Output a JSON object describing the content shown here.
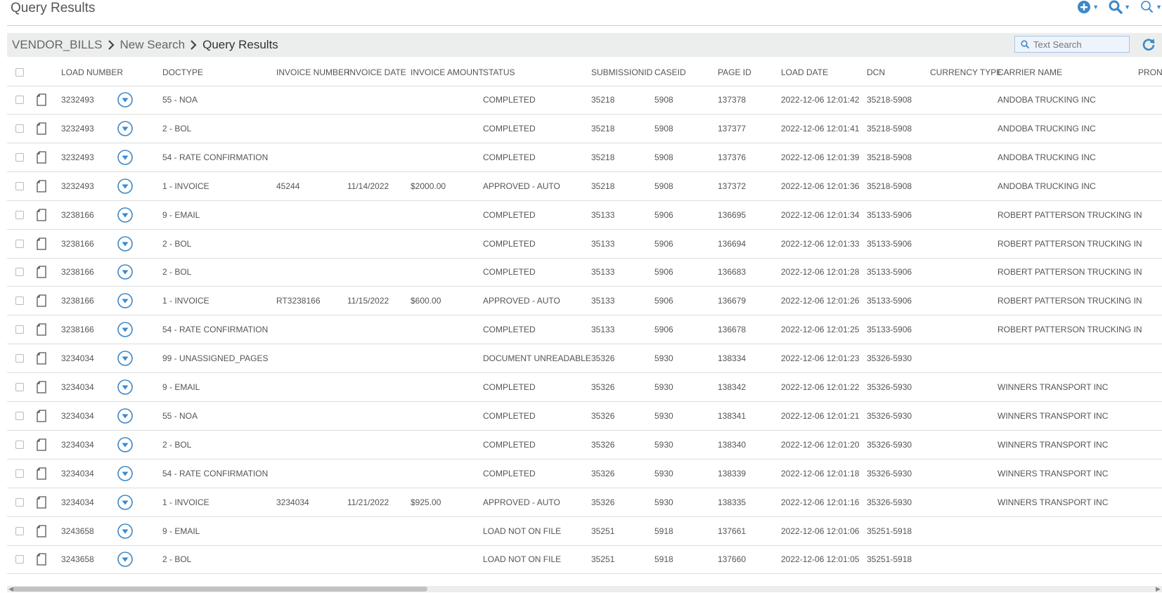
{
  "page": {
    "title": "Query Results"
  },
  "breadcrumb": [
    "VENDOR_BILLS",
    "New Search",
    "Query Results"
  ],
  "search": {
    "placeholder": "Text Search"
  },
  "colors": {
    "accent": "#3d88c8",
    "bar": "#eceded"
  },
  "icons": [
    "plus-circle-icon",
    "search-icon",
    "advanced-search-icon",
    "refresh-icon",
    "gear-icon",
    "document-icon",
    "expand-down-icon"
  ],
  "table": {
    "columns": [
      "LOAD NUMBER",
      "DOCTYPE",
      "INVOICE NUMBER",
      "INVOICE DATE",
      "INVOICE AMOUNT",
      "STATUS",
      "SUBMISSIONID",
      "CASEID",
      "PAGE ID",
      "LOAD DATE",
      "DCN",
      "CURRENCY TYPE",
      "CARRIER NAME",
      "PRONU"
    ],
    "rows": [
      [
        "3232493",
        "55 - NOA",
        "",
        "",
        "",
        "COMPLETED",
        "35218",
        "5908",
        "137378",
        "2022-12-06 12:01:42",
        "35218-5908",
        "",
        "ANDOBA TRUCKING INC"
      ],
      [
        "3232493",
        "2 - BOL",
        "",
        "",
        "",
        "COMPLETED",
        "35218",
        "5908",
        "137377",
        "2022-12-06 12:01:41",
        "35218-5908",
        "",
        "ANDOBA TRUCKING INC"
      ],
      [
        "3232493",
        "54 - RATE CONFIRMATION",
        "",
        "",
        "",
        "COMPLETED",
        "35218",
        "5908",
        "137376",
        "2022-12-06 12:01:39",
        "35218-5908",
        "",
        "ANDOBA TRUCKING INC"
      ],
      [
        "3232493",
        "1 - INVOICE",
        "45244",
        "11/14/2022",
        "$2000.00",
        "APPROVED - AUTO",
        "35218",
        "5908",
        "137372",
        "2022-12-06 12:01:36",
        "35218-5908",
        "",
        "ANDOBA TRUCKING INC"
      ],
      [
        "3238166",
        "9 - EMAIL",
        "",
        "",
        "",
        "COMPLETED",
        "35133",
        "5906",
        "136695",
        "2022-12-06 12:01:34",
        "35133-5906",
        "",
        "ROBERT PATTERSON TRUCKING IN"
      ],
      [
        "3238166",
        "2 - BOL",
        "",
        "",
        "",
        "COMPLETED",
        "35133",
        "5906",
        "136694",
        "2022-12-06 12:01:33",
        "35133-5906",
        "",
        "ROBERT PATTERSON TRUCKING IN"
      ],
      [
        "3238166",
        "2 - BOL",
        "",
        "",
        "",
        "COMPLETED",
        "35133",
        "5906",
        "136683",
        "2022-12-06 12:01:28",
        "35133-5906",
        "",
        "ROBERT PATTERSON TRUCKING IN"
      ],
      [
        "3238166",
        "1 - INVOICE",
        "RT3238166",
        "11/15/2022",
        "$600.00",
        "APPROVED - AUTO",
        "35133",
        "5906",
        "136679",
        "2022-12-06 12:01:26",
        "35133-5906",
        "",
        "ROBERT PATTERSON TRUCKING IN"
      ],
      [
        "3238166",
        "54 - RATE CONFIRMATION",
        "",
        "",
        "",
        "COMPLETED",
        "35133",
        "5906",
        "136678",
        "2022-12-06 12:01:25",
        "35133-5906",
        "",
        "ROBERT PATTERSON TRUCKING IN"
      ],
      [
        "3234034",
        "99 - UNASSIGNED_PAGES",
        "",
        "",
        "",
        "DOCUMENT UNREADABLE",
        "35326",
        "5930",
        "138334",
        "2022-12-06 12:01:23",
        "35326-5930",
        "",
        ""
      ],
      [
        "3234034",
        "9 - EMAIL",
        "",
        "",
        "",
        "COMPLETED",
        "35326",
        "5930",
        "138342",
        "2022-12-06 12:01:22",
        "35326-5930",
        "",
        "WINNERS TRANSPORT INC"
      ],
      [
        "3234034",
        "55 - NOA",
        "",
        "",
        "",
        "COMPLETED",
        "35326",
        "5930",
        "138341",
        "2022-12-06 12:01:21",
        "35326-5930",
        "",
        "WINNERS TRANSPORT INC"
      ],
      [
        "3234034",
        "2 - BOL",
        "",
        "",
        "",
        "COMPLETED",
        "35326",
        "5930",
        "138340",
        "2022-12-06 12:01:20",
        "35326-5930",
        "",
        "WINNERS TRANSPORT INC"
      ],
      [
        "3234034",
        "54 - RATE CONFIRMATION",
        "",
        "",
        "",
        "COMPLETED",
        "35326",
        "5930",
        "138339",
        "2022-12-06 12:01:18",
        "35326-5930",
        "",
        "WINNERS TRANSPORT INC"
      ],
      [
        "3234034",
        "1 - INVOICE",
        "3234034",
        "11/21/2022",
        "$925.00",
        "APPROVED - AUTO",
        "35326",
        "5930",
        "138335",
        "2022-12-06 12:01:16",
        "35326-5930",
        "",
        "WINNERS TRANSPORT INC"
      ],
      [
        "3243658",
        "9 - EMAIL",
        "",
        "",
        "",
        "LOAD NOT ON FILE",
        "35251",
        "5918",
        "137661",
        "2022-12-06 12:01:06",
        "35251-5918",
        "",
        ""
      ],
      [
        "3243658",
        "2 - BOL",
        "",
        "",
        "",
        "LOAD NOT ON FILE",
        "35251",
        "5918",
        "137660",
        "2022-12-06 12:01:05",
        "35251-5918",
        "",
        ""
      ]
    ]
  }
}
